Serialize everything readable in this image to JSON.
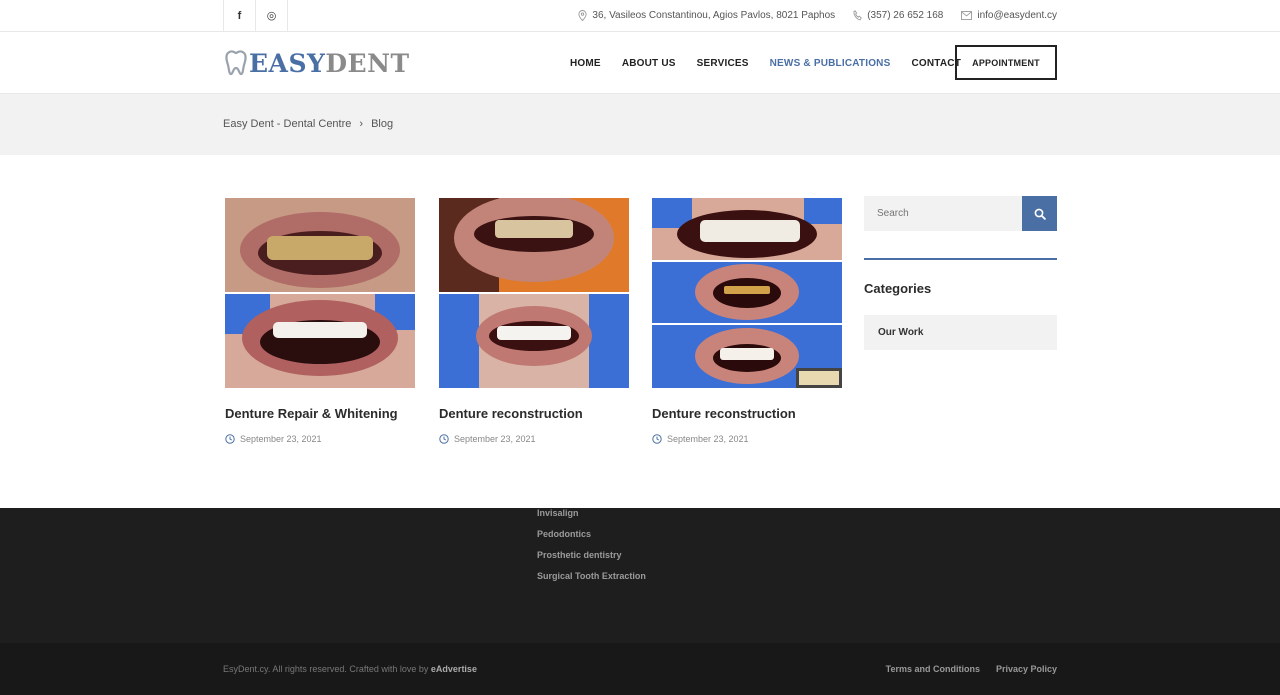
{
  "topbar": {
    "social": [
      {
        "icon": "facebook-icon",
        "glyph": "f"
      },
      {
        "icon": "instagram-icon",
        "glyph": "◎"
      }
    ],
    "address": "36, Vasileos Constantinou, Agios Pavlos, 8021 Paphos",
    "phone": "(357) 26 652 168",
    "email": "info@easydent.cy"
  },
  "header": {
    "logo_part1": "EASY",
    "logo_part2": "DENT",
    "nav": [
      {
        "label": "HOME",
        "active": false
      },
      {
        "label": "ABOUT US",
        "active": false
      },
      {
        "label": "SERVICES",
        "active": false
      },
      {
        "label": "NEWS & PUBLICATIONS",
        "active": true
      },
      {
        "label": "CONTACT",
        "active": false
      }
    ],
    "cta": "APPOINTMENT"
  },
  "breadcrumb": {
    "home": "Easy Dent - Dental Centre",
    "separator": "›",
    "current": "Blog"
  },
  "posts": [
    {
      "title": "Denture Repair & Whitening",
      "date": "September 23, 2021"
    },
    {
      "title": "Denture reconstruction",
      "date": "September 23, 2021"
    },
    {
      "title": "Denture reconstruction",
      "date": "September 23, 2021"
    }
  ],
  "sidebar": {
    "search_placeholder": "Search",
    "categories_title": "Categories",
    "categories": [
      "Our Work"
    ]
  },
  "footer": {
    "links": [
      "Invisalign",
      "Pedodontics",
      "Prosthetic dentistry",
      "Surgical Tooth Extraction"
    ],
    "copyright_text": "EsyDent.cy. All rights reserved. Crafted with love by ",
    "copyright_brand": "eAdvertise",
    "legal": [
      "Terms and Conditions",
      "Privacy Policy"
    ]
  },
  "colors": {
    "accent": "#4a6fa5",
    "footer_bg": "#1e1e1e",
    "band_bg": "#f2f2f2"
  }
}
